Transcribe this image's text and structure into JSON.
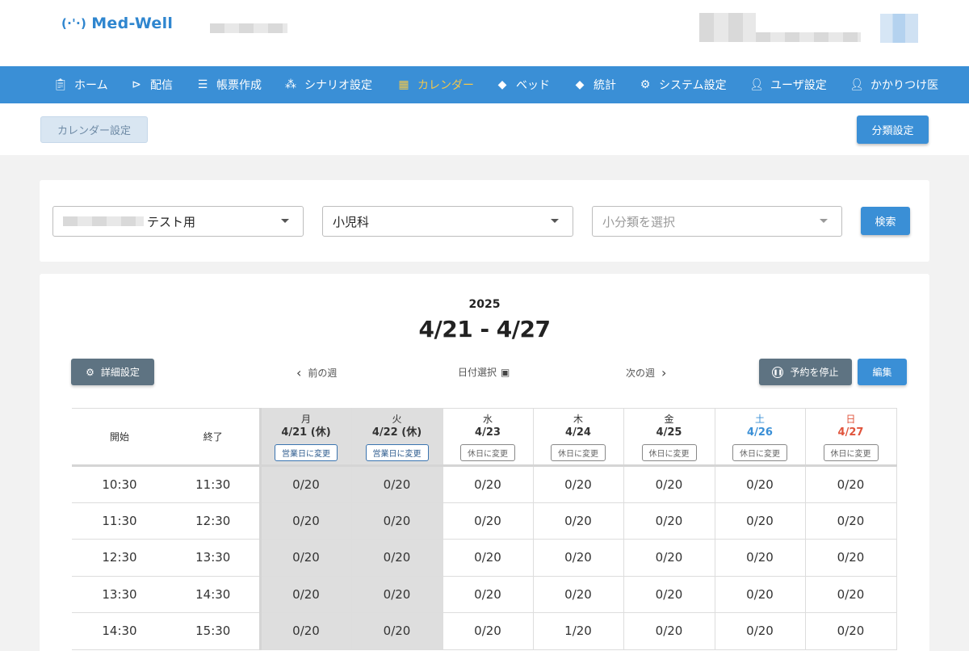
{
  "app": {
    "logo_text": "Med-Well",
    "logo_mark": "(·'·)"
  },
  "nav": [
    {
      "label": "ホーム",
      "icon": "clipboard-icon"
    },
    {
      "label": "配信",
      "icon": "megaphone-icon"
    },
    {
      "label": "帳票作成",
      "icon": "document-icon"
    },
    {
      "label": "シナリオ設定",
      "icon": "flow-icon"
    },
    {
      "label": "カレンダー",
      "icon": "calendar-clock-icon",
      "active": true
    },
    {
      "label": "ベッド",
      "icon": "cube-icon"
    },
    {
      "label": "統計",
      "icon": "cube-stat-icon"
    },
    {
      "label": "システム設定",
      "icon": "gear-icon"
    },
    {
      "label": "ユーザ設定",
      "icon": "user-gear-icon"
    },
    {
      "label": "かかりつけ医",
      "icon": "doctor-gear-icon"
    }
  ],
  "subbar": {
    "calendar_settings": "カレンダー設定",
    "classification_settings": "分類設定"
  },
  "filter": {
    "facility_value": "テスト用",
    "department_value": "小児科",
    "subcategory_placeholder": "小分類を選択",
    "search_label": "検索"
  },
  "calendar": {
    "year": "2025",
    "range": "4/21 - 4/27",
    "detail_settings": "詳細設定",
    "prev_week": "前の週",
    "date_select": "日付選択",
    "next_week": "次の週",
    "stop_booking": "予約を停止",
    "edit": "編集",
    "col_start": "開始",
    "col_end": "終了",
    "days": [
      {
        "dow": "月",
        "date": "4/21 (休)",
        "tag": "営業日に変更",
        "holiday": true
      },
      {
        "dow": "火",
        "date": "4/22 (休)",
        "tag": "営業日に変更",
        "holiday": true
      },
      {
        "dow": "水",
        "date": "4/23",
        "tag": "休日に変更",
        "holiday": false
      },
      {
        "dow": "木",
        "date": "4/24",
        "tag": "休日に変更",
        "holiday": false
      },
      {
        "dow": "金",
        "date": "4/25",
        "tag": "休日に変更",
        "holiday": false
      },
      {
        "dow": "土",
        "date": "4/26",
        "tag": "休日に変更",
        "holiday": false
      },
      {
        "dow": "日",
        "date": "4/27",
        "tag": "休日に変更",
        "holiday": false
      }
    ],
    "rows": [
      {
        "start": "10:30",
        "end": "11:30",
        "slots": [
          "0/20",
          "0/20",
          "0/20",
          "0/20",
          "0/20",
          "0/20",
          "0/20"
        ]
      },
      {
        "start": "11:30",
        "end": "12:30",
        "slots": [
          "0/20",
          "0/20",
          "0/20",
          "0/20",
          "0/20",
          "0/20",
          "0/20"
        ]
      },
      {
        "start": "12:30",
        "end": "13:30",
        "slots": [
          "0/20",
          "0/20",
          "0/20",
          "0/20",
          "0/20",
          "0/20",
          "0/20"
        ]
      },
      {
        "start": "13:30",
        "end": "14:30",
        "slots": [
          "0/20",
          "0/20",
          "0/20",
          "0/20",
          "0/20",
          "0/20",
          "0/20"
        ]
      },
      {
        "start": "14:30",
        "end": "15:30",
        "slots": [
          "0/20",
          "0/20",
          "0/20",
          "1/20",
          "0/20",
          "0/20",
          "0/20"
        ]
      }
    ]
  }
}
